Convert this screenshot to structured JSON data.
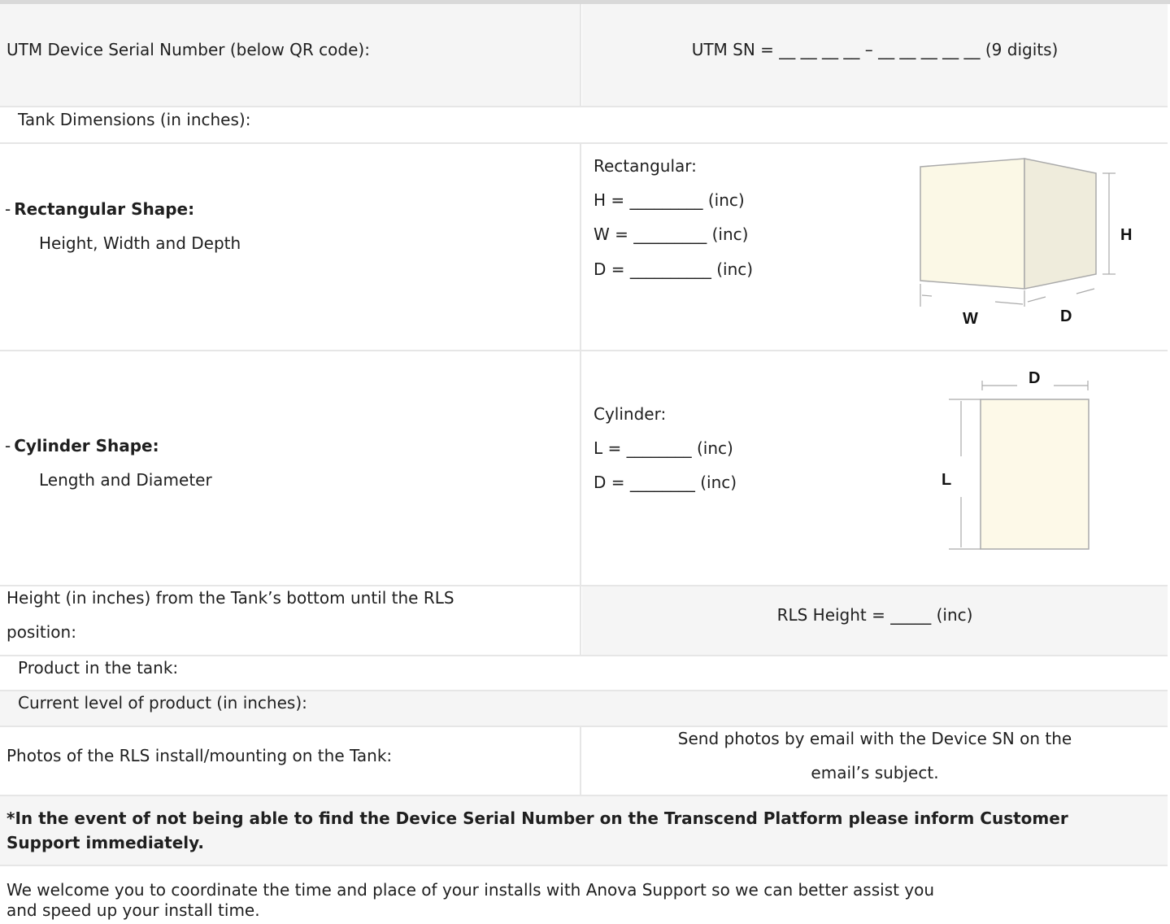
{
  "serial": {
    "label": "UTM Device Serial Number (below QR code):",
    "value": "UTM SN = __ __ __ __ – __ __ __ __ __ (9 digits)"
  },
  "tank_dimensions": {
    "label": "Tank Dimensions (in inches):"
  },
  "rectangular": {
    "dash": "-",
    "title": "Rectangular Shape:",
    "subtitle": "Height, Width and Depth",
    "heading": "Rectangular:",
    "h_line": "H = _________ (inc)",
    "w_line": "W = _________ (inc)",
    "d_line": "D = __________ (inc)",
    "diagram": {
      "h": "H",
      "w": "W",
      "d": "D",
      "fill": "#fbf8e6",
      "side_fill": "#efecdc"
    }
  },
  "cylinder": {
    "dash": "-",
    "title": "Cylinder Shape:",
    "subtitle": "Length and Diameter",
    "heading": "Cylinder:",
    "l_line": "L = ________ (inc)",
    "d_line": "D = ________ (inc)",
    "diagram": {
      "d": "D",
      "l": "L",
      "fill": "#fdf9e8"
    }
  },
  "rls_height": {
    "label_line1": "Height (in inches) from the Tank’s bottom until the RLS",
    "label_line2": "position:",
    "value": "RLS Height = _____ (inc)"
  },
  "product": {
    "label": "Product in the tank:"
  },
  "current_level": {
    "label": "Current level of product (in inches):"
  },
  "photos": {
    "label": "Photos of the RLS install/mounting on the Tank:",
    "value_line1": "Send photos by email with the Device SN on the",
    "value_line2": "email’s subject."
  },
  "note": {
    "line1": "*In the event of not being able to find the Device Serial Number on the Transcend Platform please inform Customer",
    "line2": "Support immediately."
  },
  "welcome": {
    "line1": "We welcome you to coordinate the time and place of your installs with Anova Support so we can better assist you",
    "line2": "and speed up your install time."
  }
}
